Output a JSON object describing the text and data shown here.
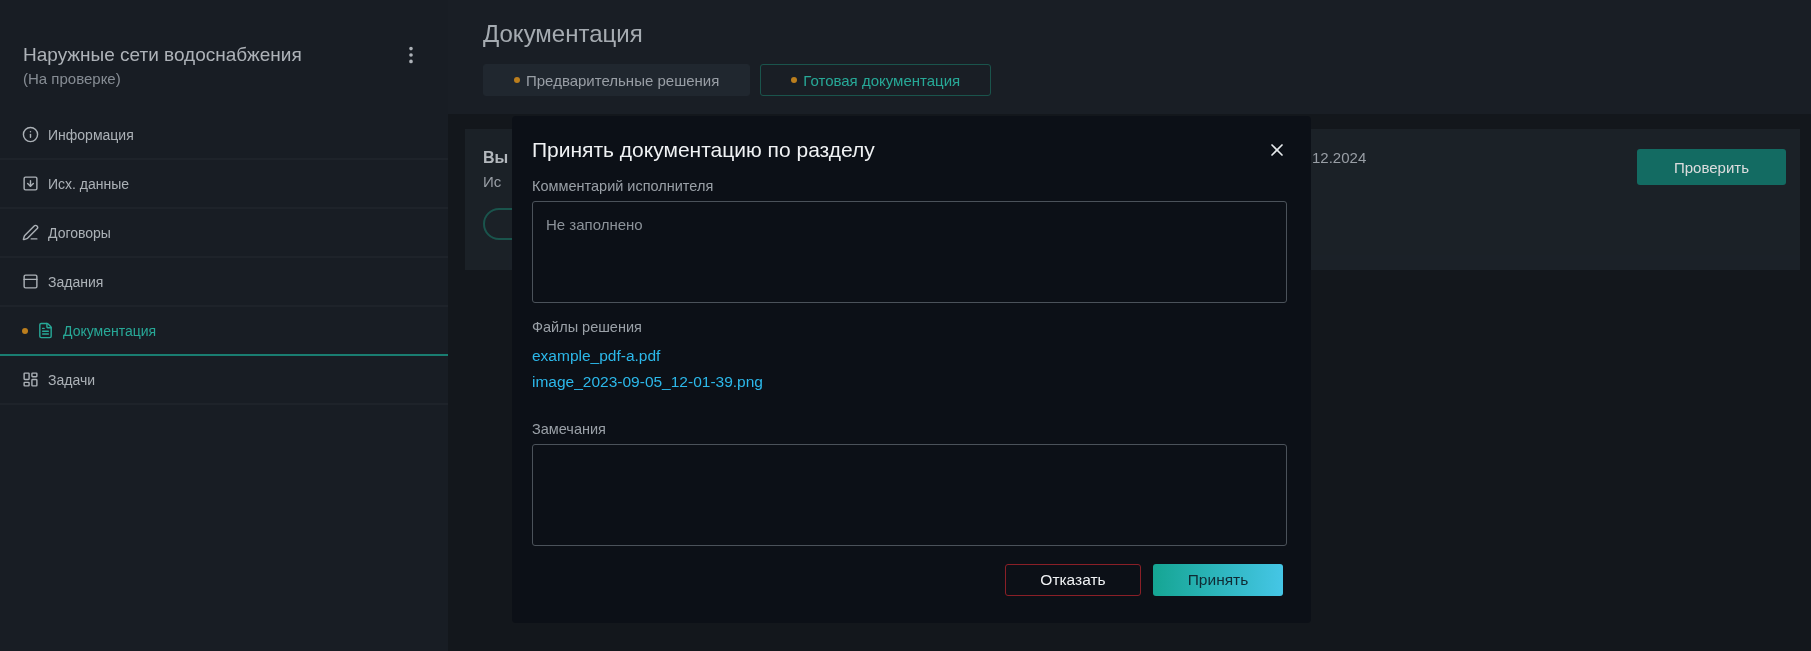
{
  "sidebar": {
    "title": "Наружные сети водоснабжения",
    "status": "(На проверке)",
    "items": [
      {
        "label": "Информация",
        "selected": false,
        "dot": false
      },
      {
        "label": "Исх. данные",
        "selected": false,
        "dot": false
      },
      {
        "label": "Договоры",
        "selected": false,
        "dot": false
      },
      {
        "label": "Задания",
        "selected": false,
        "dot": false
      },
      {
        "label": "Документация",
        "selected": true,
        "dot": true
      },
      {
        "label": "Задачи",
        "selected": false,
        "dot": false
      }
    ]
  },
  "page": {
    "title": "Документация",
    "tabs": [
      {
        "label": "Предварительные решения",
        "selected": false,
        "dot": true
      },
      {
        "label": "Готовая документация",
        "selected": true,
        "dot": true
      }
    ],
    "card": {
      "title": "Вы",
      "subtitle": "Ис",
      "date": "12.2024",
      "button": "Проверить"
    }
  },
  "dialog": {
    "title": "Принять документацию по разделу",
    "comment_label": "Комментарий исполнителя",
    "comment_placeholder": "Не заполнено",
    "files_label": "Файлы решения",
    "files": [
      "example_pdf-a.pdf",
      "image_2023-09-05_12-01-39.png"
    ],
    "remarks_label": "Замечания",
    "buttons": [
      {
        "label": "Отказать",
        "kind": "reject"
      },
      {
        "label": "Принять",
        "kind": "accept"
      }
    ]
  }
}
